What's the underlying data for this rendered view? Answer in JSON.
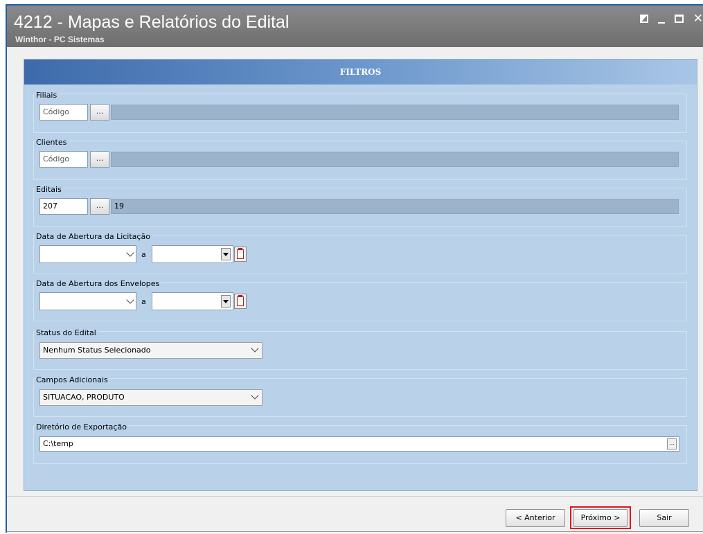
{
  "window": {
    "title": "4212 - Mapas e Relatórios do Edital",
    "subtitle": "Winthor - PC Sistemas",
    "controls": [
      "restore-icon",
      "minimize-icon",
      "maximize-icon",
      "close-icon"
    ]
  },
  "panel": {
    "header": "FILTROS"
  },
  "filters": {
    "filiais": {
      "label": "Filiais",
      "code_placeholder": "Código",
      "code_value": "",
      "lookup_label": "...",
      "description": ""
    },
    "clientes": {
      "label": "Clientes",
      "code_placeholder": "Código",
      "code_value": "",
      "lookup_label": "...",
      "description": ""
    },
    "editais": {
      "label": "Editais",
      "code_value": "207",
      "lookup_label": "...",
      "description": "19"
    },
    "data_abertura_licitacao": {
      "label": "Data de Abertura da Licitação",
      "from": "",
      "separator": "a",
      "to": ""
    },
    "data_abertura_envelopes": {
      "label": "Data de Abertura dos Envelopes",
      "from": "",
      "separator": "a",
      "to": ""
    },
    "status_edital": {
      "label": "Status do Edital",
      "selected": "Nenhum Status Selecionado"
    },
    "campos_adicionais": {
      "label": "Campos Adicionais",
      "selected": "SITUACAO, PRODUTO"
    },
    "diretorio_exportacao": {
      "label": "Diretório de Exportação",
      "value": "C:\\temp",
      "browse_label": "..."
    }
  },
  "footer": {
    "anterior": "< Anterior",
    "proximo": "Próximo >",
    "sair": "Sair",
    "highlight_color": "#e0141e"
  },
  "colors": {
    "panel_bg": "#b9d2ea",
    "header_gradient_start": "#3d6aaa",
    "titlebar": "#7a7a7a"
  }
}
